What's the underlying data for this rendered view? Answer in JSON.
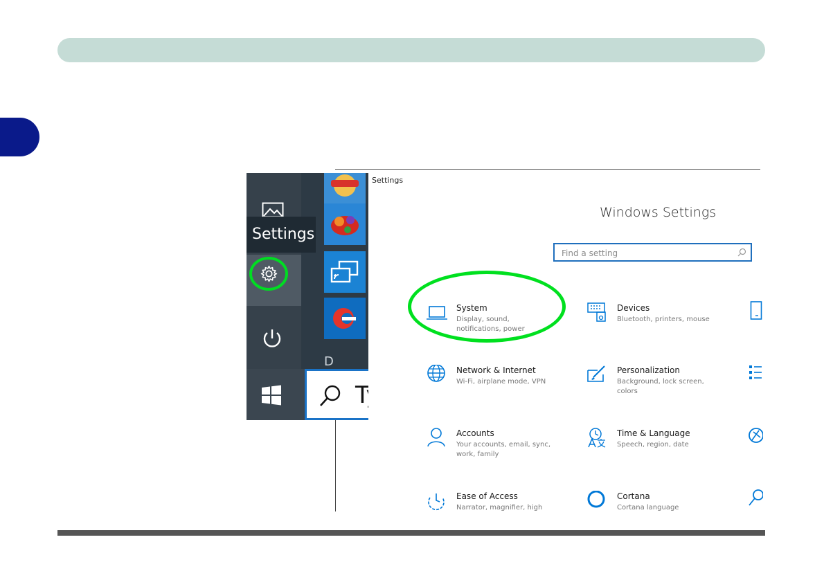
{
  "start_menu": {
    "tooltip": "Settings",
    "search_text": "Ty",
    "letter_header": "D",
    "icons": [
      "photos-icon",
      "settings-gear-icon",
      "power-icon",
      "windows-logo-icon",
      "search-icon"
    ],
    "tiles": [
      "game-tile",
      "candy-crush-tile",
      "connect-tile",
      "app-tile"
    ]
  },
  "settings_window": {
    "title": "Settings",
    "heading": "Windows Settings",
    "search_placeholder": "Find a setting",
    "items": [
      {
        "title": "System",
        "subtitle": "Display, sound, notifications, power",
        "icon": "laptop-icon"
      },
      {
        "title": "Devices",
        "subtitle": "Bluetooth, printers, mouse",
        "icon": "keyboard-icon"
      },
      {
        "title": "Network & Internet",
        "subtitle": "Wi-Fi, airplane mode, VPN",
        "icon": "globe-icon"
      },
      {
        "title": "Personalization",
        "subtitle": "Background, lock screen, colors",
        "icon": "paint-icon"
      },
      {
        "title": "Accounts",
        "subtitle": "Your accounts, email, sync, work, family",
        "icon": "person-icon"
      },
      {
        "title": "Time & Language",
        "subtitle": "Speech, region, date",
        "icon": "time-language-icon"
      },
      {
        "title": "Ease of Access",
        "subtitle": "Narrator, magnifier, high",
        "icon": "ease-of-access-icon"
      },
      {
        "title": "Cortana",
        "subtitle": "Cortana language",
        "icon": "cortana-icon"
      }
    ]
  },
  "colors": {
    "accent_blue": "#0078d7",
    "highlight_green": "#00e01f",
    "top_bar": "#c5dcd6",
    "side_tab": "#0a1a8a"
  }
}
